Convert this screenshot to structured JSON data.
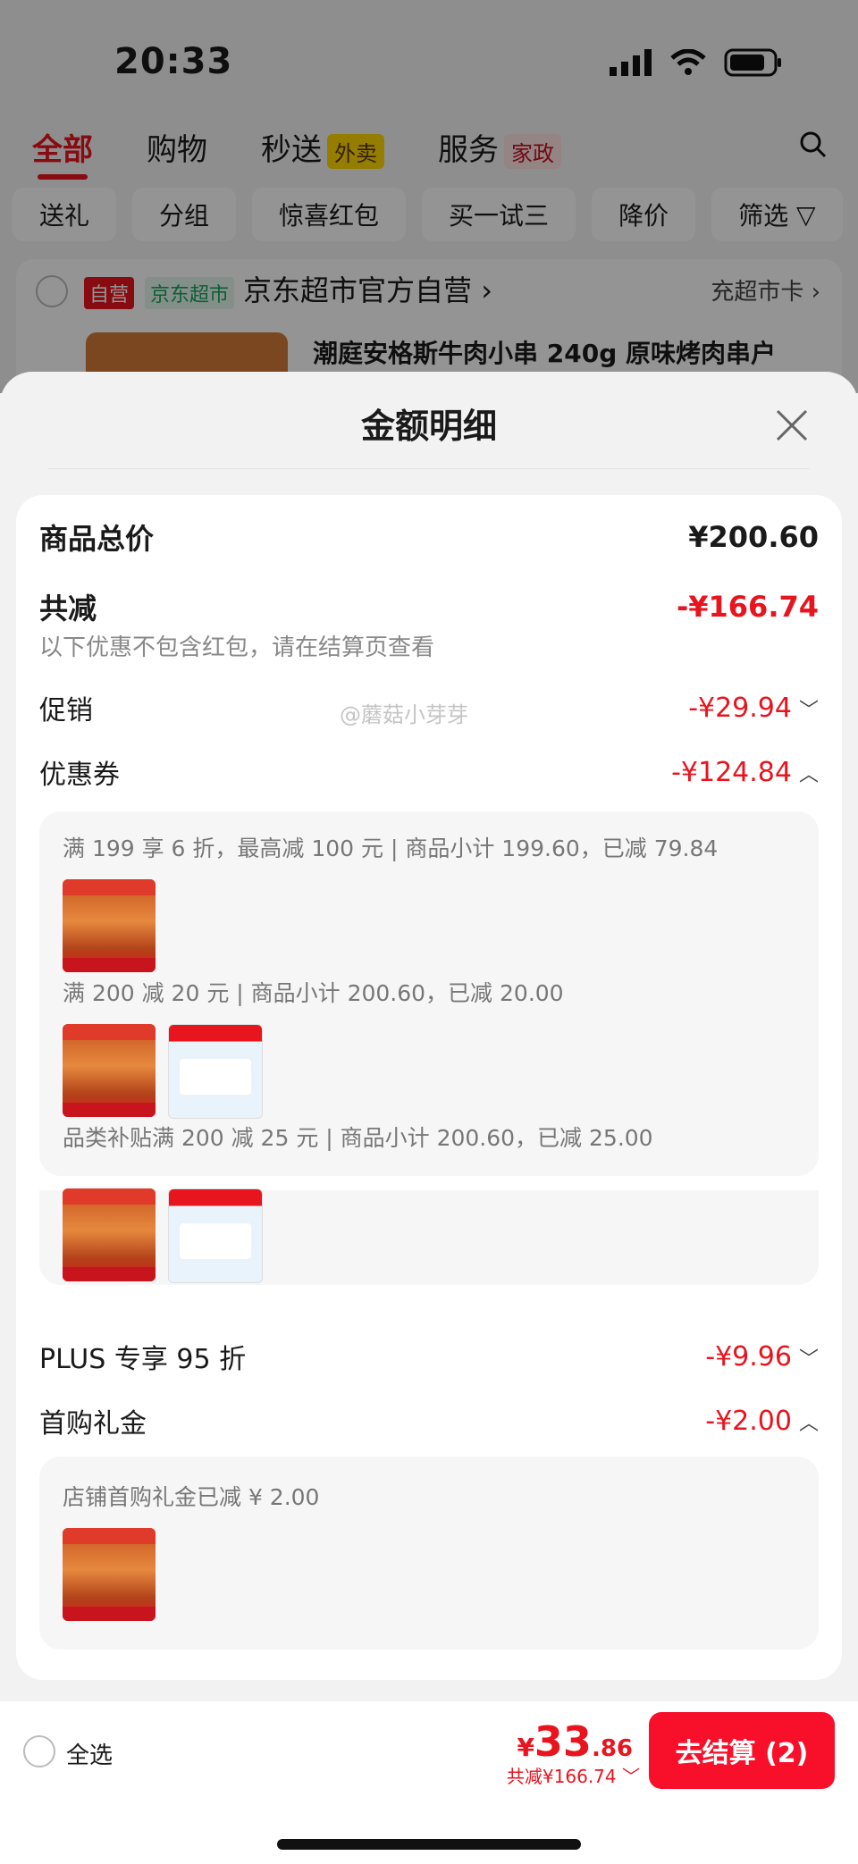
{
  "status": {
    "time": "20:33"
  },
  "top_tabs": [
    {
      "label": "全部",
      "tag": ""
    },
    {
      "label": "购物",
      "tag": ""
    },
    {
      "label": "秒送",
      "tag": "外卖"
    },
    {
      "label": "服务",
      "tag": "家政"
    }
  ],
  "filters": [
    "送礼",
    "分组",
    "惊喜红包",
    "买一试三",
    "降价",
    "筛选"
  ],
  "store": {
    "badge_self": "自营",
    "badge_market": "京东超市",
    "name": "京东超市官方自营",
    "card_link": "充超市卡",
    "product_title": "潮庭安格斯牛肉小串 240g  原味烤肉串户"
  },
  "sheet": {
    "title": "金额明细",
    "total_label": "商品总价",
    "total_value": "¥200.60",
    "reduce_label": "共减",
    "reduce_value": "-¥166.74",
    "note": "以下优惠不包含红包，请在结算页查看",
    "promo_label": "促销",
    "promo_value": "-¥29.94",
    "coupon_label": "优惠券",
    "coupon_value": "-¥124.84",
    "coupons": [
      {
        "condition": "满 199 享 6 折，最高减 100 元 | 商品小计 199.60，已减 79.84"
      },
      {
        "condition": "满 200 减 20 元 | 商品小计 200.60，已减 20.00"
      },
      {
        "condition": "品类补贴满 200 减 25 元 | 商品小计 200.60，已减 25.00"
      }
    ],
    "plus_label": "PLUS 专享 95 折",
    "plus_value": "-¥9.96",
    "gift_label": "首购礼金",
    "gift_value": "-¥2.00",
    "gift_condition": "店铺首购礼金已减 ¥ 2.00"
  },
  "watermark": "@蘑菇小芽芽",
  "bottom": {
    "select_all": "全选",
    "currency": "¥",
    "price_int": "33",
    "price_dec": ".86",
    "saved": "共减¥166.74",
    "checkout": "去结算 (2)"
  }
}
